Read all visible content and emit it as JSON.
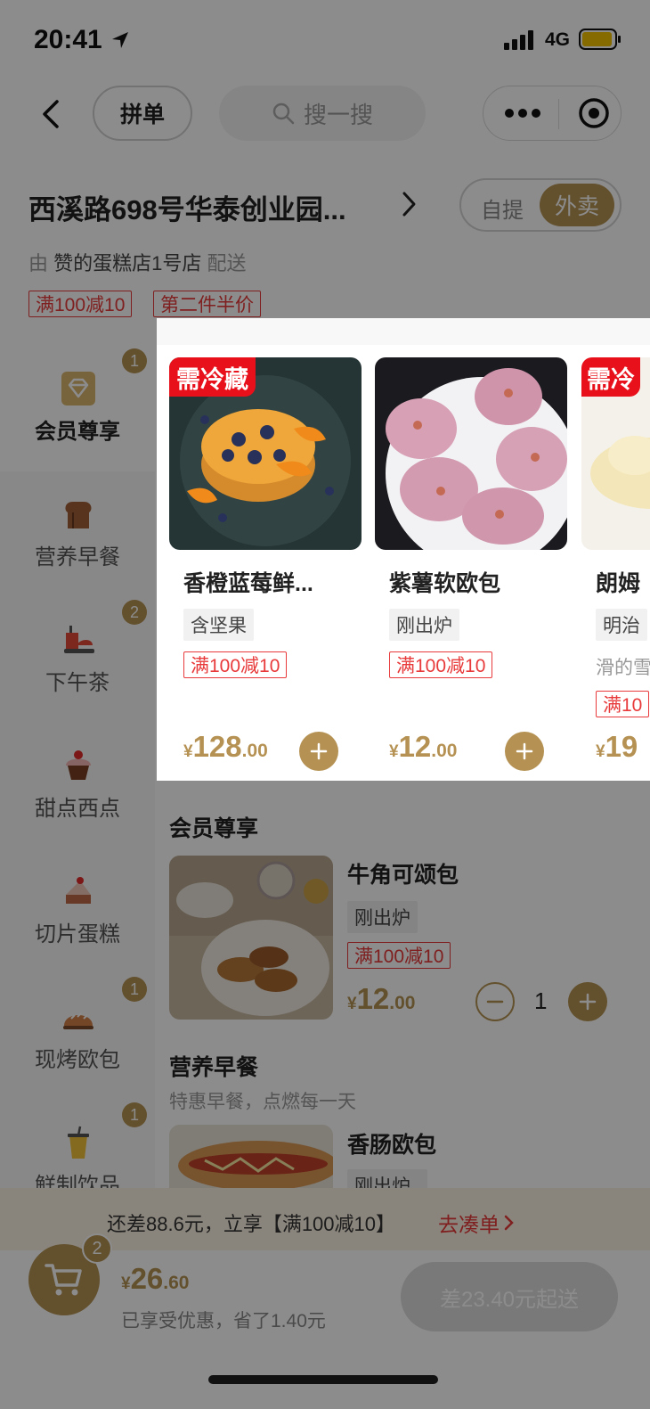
{
  "status": {
    "time": "20:41",
    "network": "4G"
  },
  "nav": {
    "group_order": "拼单",
    "search_placeholder": "搜一搜"
  },
  "store": {
    "address": "西溪路698号华泰创业园...",
    "mode_pickup": "自提",
    "mode_delivery": "外卖",
    "deliver_prefix": "由",
    "shop_name": "赞的蛋糕店1号店",
    "deliver_suffix": "配送",
    "tags": [
      "满100减10",
      "第二件半价"
    ]
  },
  "sidebar": {
    "items": [
      {
        "label": "会员尊享",
        "badge": "1",
        "icon": "gem-icon"
      },
      {
        "label": "营养早餐",
        "badge": "",
        "icon": "toast-icon"
      },
      {
        "label": "下午茶",
        "badge": "2",
        "icon": "tea-set-icon"
      },
      {
        "label": "甜点西点",
        "badge": "",
        "icon": "cupcake-icon"
      },
      {
        "label": "切片蛋糕",
        "badge": "",
        "icon": "cake-slice-icon"
      },
      {
        "label": "现烤欧包",
        "badge": "1",
        "icon": "bread-icon"
      },
      {
        "label": "鲜制饮品",
        "badge": "1",
        "icon": "drink-icon"
      }
    ]
  },
  "popup": {
    "cards": [
      {
        "cold_label": "需冷藏",
        "name": "香橙蓝莓鲜...",
        "chip": "含坚果",
        "tag": "满100减10",
        "currency": "¥",
        "price_int": "128",
        "price_dec": ".00"
      },
      {
        "cold_label": "",
        "name": "紫薯软欧包",
        "chip": "刚出炉",
        "tag": "满100减10",
        "currency": "¥",
        "price_int": "12",
        "price_dec": ".00"
      },
      {
        "cold_label": "需冷",
        "name": "朗姆",
        "chip": "明治",
        "desc": "滑的雪",
        "tag": "满10",
        "currency": "¥",
        "price_int": "19",
        "price_dec": ""
      }
    ]
  },
  "list": {
    "section1": {
      "title": "会员尊享"
    },
    "item1": {
      "name": "牛角可颂包",
      "chip": "刚出炉",
      "tag": "满100减10",
      "currency": "¥",
      "price_int": "12",
      "price_dec": ".00",
      "qty": "1"
    },
    "section2": {
      "title": "营养早餐",
      "subtitle": "特惠早餐，点燃每一天"
    },
    "item2": {
      "name": "香肠欧包",
      "chip": "刚出炉"
    }
  },
  "promo": {
    "text": "还差88.6元，立享【满100减10】",
    "action": "去凑单"
  },
  "checkout": {
    "cart_count": "2",
    "currency": "¥",
    "total_int": "26",
    "total_dec": ".60",
    "saved": "已享受优惠，省了1.40元",
    "button": "差23.40元起送"
  },
  "colors": {
    "accent": "#b59253",
    "promo_red": "#e83a3a",
    "cold_red": "#e8101a"
  }
}
